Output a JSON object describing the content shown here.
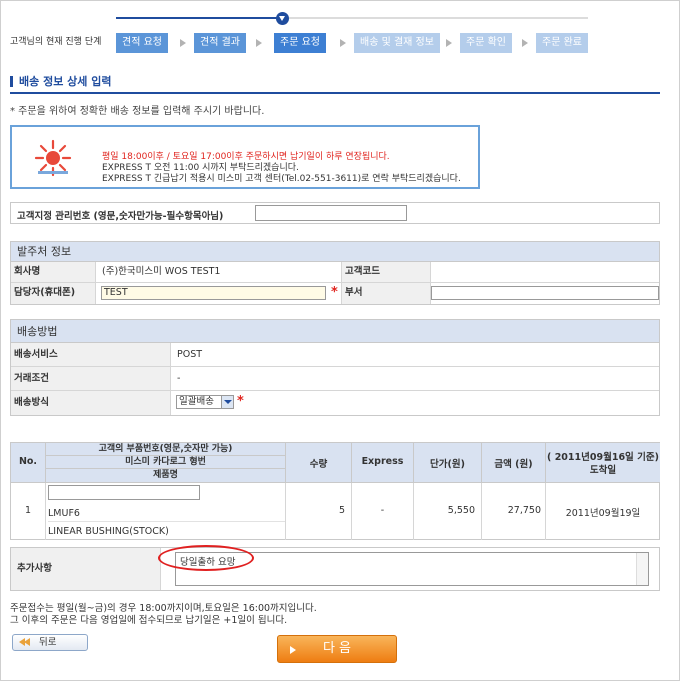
{
  "progress": {
    "label": "고객님의 현재 진행 단계",
    "steps": [
      "견적 요청",
      "견적 결과",
      "주문 요청",
      "배송 및 결재 정보",
      "주문 확인",
      "주문 완료"
    ]
  },
  "section_title": "배송 정보 상세 입력",
  "intro": "* 주문을 위하여 정확한 배송 정보를 입력해 주시기 바랍니다.",
  "notice": {
    "line1": "평일 18:00이후 / 토요일 17:00이후 주문하시면 납기일이 하루 연장됩니다.",
    "line2": "EXPRESS T 오전 11:00 시까지 부탁드리겠습니다.",
    "line3": "EXPRESS T 긴급납기 적용시 미스미 고객 센터(Tel.02-551-3611)로 연락 부탁드리겠습니다."
  },
  "customer_ref": {
    "label": "고객지정 관리번호 (영문,숫자만가능-필수항목아님)",
    "value": ""
  },
  "orderer": {
    "title": "발주처 정보",
    "company_label": "회사명",
    "company_value": "(주)한국미스미 WOS TEST1",
    "customer_code_label": "고객코드",
    "customer_code_value": "",
    "contact_label": "담당자(휴대폰)",
    "contact_value": "TEST",
    "required_mark": "*",
    "dept_label": "부서",
    "dept_value": ""
  },
  "shipping": {
    "title": "배송방법",
    "service_label": "배송서비스",
    "service_value": "POST",
    "terms_label": "거래조건",
    "terms_value": "-",
    "method_label": "배송방식",
    "method_value": "일괄배송",
    "required_mark": "*"
  },
  "items": {
    "headers": {
      "no": "No.",
      "part_no": "고객의 부품번호(영문,숫자만 가능)",
      "misumi_no": "미스미 카다로그 형번",
      "product": "제품명",
      "qty": "수량",
      "express": "Express",
      "unit_price": "단가(원)",
      "amount": "금액 (원)",
      "date_basis": "( 2011년09월16일 기준)",
      "delivery": "도착일"
    },
    "rows": [
      {
        "no": "1",
        "part_no": "",
        "misumi_no": "LMUF6",
        "product": "LINEAR BUSHING(STOCK)",
        "qty": "5",
        "express": "-",
        "unit_price": "5,550",
        "amount": "27,750",
        "delivery": "2011년09월19일"
      }
    ]
  },
  "remarks": {
    "label": "추가사항",
    "value": "당일출하 요망"
  },
  "footer": {
    "line1": "주문접수는 평일(월~금)의 경우 18:00까지이며,토요일은 16:00까지입니다.",
    "line2": "그 이후의 주문은 다음 영업일에 접수되므로 납기일은 +1일이 됩니다."
  },
  "buttons": {
    "back": "뒤로",
    "next": "다 음"
  },
  "colors": {
    "accent": "#1f4c9e",
    "header_bg": "#d9e2f1",
    "next_button": "#ee7d12",
    "highlight": "#e02020"
  }
}
